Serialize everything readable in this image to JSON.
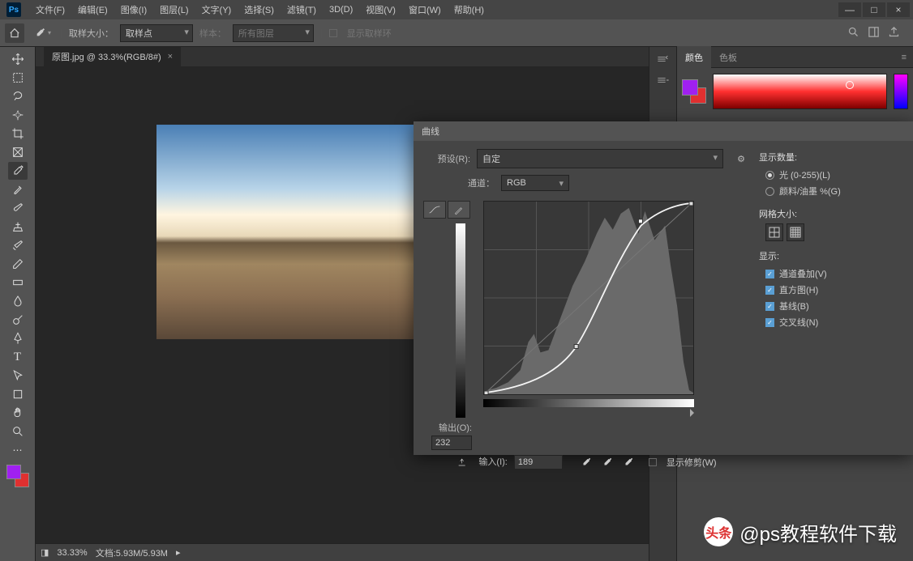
{
  "app": {
    "logo": "Ps"
  },
  "menu": [
    "文件(F)",
    "编辑(E)",
    "图像(I)",
    "图层(L)",
    "文字(Y)",
    "选择(S)",
    "滤镜(T)",
    "3D(D)",
    "视图(V)",
    "窗口(W)",
    "帮助(H)"
  ],
  "win": {
    "min": "—",
    "max": "□",
    "close": "×"
  },
  "options": {
    "sample_size_label": "取样大小：",
    "sample_size_value": "取样点",
    "sample_label": "样本：",
    "sample_value": "所有图层",
    "show_ring": "显示取样环"
  },
  "doc": {
    "tab": "原图.jpg @ 33.3%(RGB/8#)",
    "close": "×"
  },
  "status": {
    "zoom": "33.33%",
    "doc": "文档:5.93M/5.93M",
    "arrow": "▸"
  },
  "color_panel": {
    "tab1": "颜色",
    "tab2": "色板"
  },
  "curves": {
    "title": "曲线",
    "preset_label": "预设(R):",
    "preset_value": "自定",
    "channel_label": "通道：",
    "channel_value": "RGB",
    "output_label": "输出(O):",
    "output_value": "232",
    "input_label": "输入(I):",
    "input_value": "189",
    "show_clip": "显示修剪(W)",
    "display_amount": "显示数量:",
    "light": "光 (0-255)(L)",
    "pigment": "颜料/油墨 %(G)",
    "grid_label": "网格大小:",
    "show_label": "显示:",
    "opts": [
      "通道叠加(V)",
      "直方图(H)",
      "基线(B)",
      "交叉线(N)"
    ]
  },
  "watermark": {
    "icon": "头条",
    "text": "@ps教程软件下载"
  }
}
